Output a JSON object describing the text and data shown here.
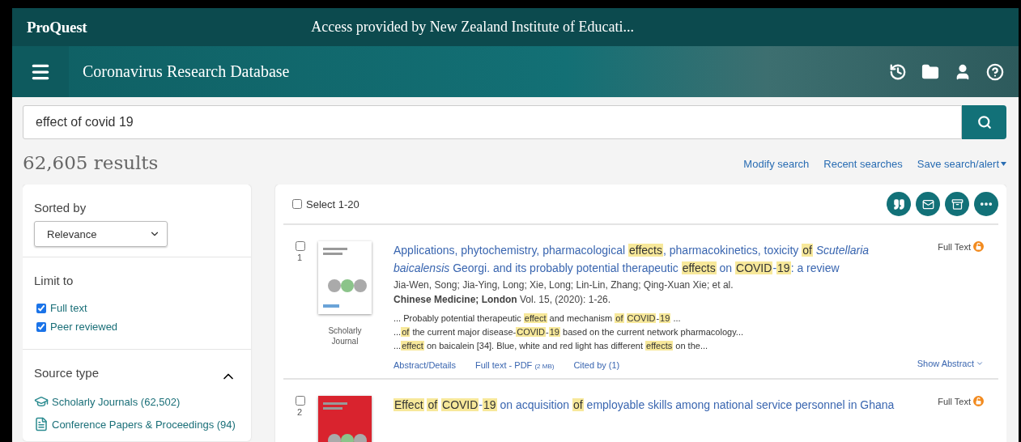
{
  "header": {
    "brand": "ProQuest",
    "access_text": "Access provided by New Zealand Institute of Educati...",
    "database_title": "Coronavirus Research Database"
  },
  "search": {
    "value": "effect of covid 19"
  },
  "results_count": "62,605 results",
  "search_links": [
    {
      "label": "Modify search",
      "caret": false
    },
    {
      "label": "Recent searches",
      "caret": false
    },
    {
      "label": "Save search/alert",
      "caret": true
    }
  ],
  "sidebar": {
    "sort_label": "Sorted by",
    "sort_value": "Relevance",
    "limit_title": "Limit to",
    "limits": [
      {
        "label": "Full text",
        "checked": true
      },
      {
        "label": "Peer reviewed",
        "checked": true
      }
    ],
    "source_type": {
      "title": "Source type",
      "expanded": true,
      "items": [
        {
          "kind": "journal",
          "label": "Scholarly Journals (62,502)"
        },
        {
          "kind": "conference",
          "label": "Conference Papers & Proceedings (94)"
        }
      ]
    }
  },
  "select_all": {
    "label": "Select 1-20",
    "checked": false
  },
  "results": [
    {
      "number": "1",
      "checked": false,
      "color": "#ffffff",
      "source_type": "Scholarly Journal",
      "full_text_label": "Full Text",
      "title": [
        {
          "text": "Applications, phytochemistry, pharmacological ",
          "highlight": false
        },
        {
          "text": "effects",
          "highlight": true
        },
        {
          "text": ", pharmacokinetics, toxicity ",
          "highlight": false
        },
        {
          "text": "of",
          "highlight": true
        },
        {
          "text": " *Scutellaria baicalensis* Georgi. and its probably potential therapeutic ",
          "highlight": false
        },
        {
          "text": "effects",
          "highlight": true
        },
        {
          "text": " on ",
          "highlight": false
        },
        {
          "text": "COVID",
          "highlight": true
        },
        {
          "text": "-",
          "highlight": false
        },
        {
          "text": "19",
          "highlight": true
        },
        {
          "text": ": a review",
          "highlight": false
        }
      ],
      "authors": "Jia-Wen, Song; Jia-Ying, Long; Xie, Long; Lin-Lin, Zhang; Qing-Xuan Xie; et al.",
      "source": "**Chinese Medicine; London** Vol. 15,  (2020): 1-26.",
      "snippets": [
        [
          {
            "text": "... Probably potential therapeutic ",
            "highlight": false
          },
          {
            "text": "effect",
            "highlight": true
          },
          {
            "text": " and mechanism ",
            "highlight": false
          },
          {
            "text": "of",
            "highlight": true,
            "space_after": true
          },
          {
            "text": "COVID",
            "highlight": true
          },
          {
            "text": "-",
            "highlight": false
          },
          {
            "text": "19",
            "highlight": true
          },
          {
            "text": " ...",
            "highlight": false
          }
        ],
        [
          {
            "text": "...",
            "highlight": false
          },
          {
            "text": "of",
            "highlight": true
          },
          {
            "text": " the current major disease-",
            "highlight": false
          },
          {
            "text": "COVID",
            "highlight": true
          },
          {
            "text": "-",
            "highlight": false
          },
          {
            "text": "19",
            "highlight": true
          },
          {
            "text": " based on the current network pharmacology...",
            "highlight": false
          }
        ],
        [
          {
            "text": "...",
            "highlight": false
          },
          {
            "text": "effect",
            "highlight": true
          },
          {
            "text": " on baicalein [34]. Blue, white and red light has different ",
            "highlight": false
          },
          {
            "text": "effects",
            "highlight": true
          },
          {
            "text": " on the...",
            "highlight": false
          }
        ]
      ],
      "links": [
        {
          "label": "Abstract/Details"
        },
        {
          "label": "Full text - PDF",
          "size": "(2 MB)"
        },
        {
          "label": "Cited by (1)"
        }
      ],
      "show_abstract": "Show Abstract"
    },
    {
      "number": "2",
      "checked": false,
      "color": "#d9232e",
      "full_text_label": "Full Text",
      "title": [
        {
          "text": "Effect",
          "highlight": true,
          "space_after": true
        },
        {
          "text": "of",
          "highlight": true,
          "space_after": true
        },
        {
          "text": "COVID",
          "highlight": true
        },
        {
          "text": "-",
          "highlight": false
        },
        {
          "text": "19",
          "highlight": true
        },
        {
          "text": " on acquisition ",
          "highlight": false
        },
        {
          "text": "of",
          "highlight": true
        },
        {
          "text": " employable skills among national service personnel in Ghana",
          "highlight": false
        }
      ]
    }
  ]
}
